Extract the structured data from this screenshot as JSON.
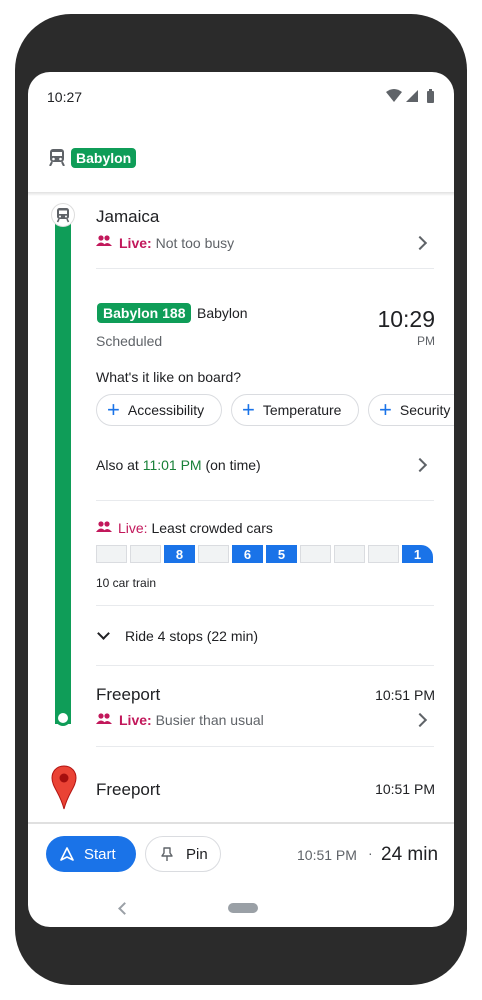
{
  "status_bar": {
    "time": "10:27"
  },
  "header": {
    "route_chip": "Babylon"
  },
  "stops": {
    "origin": {
      "name": "Jamaica",
      "live_label": "Live:",
      "live_status": "Not too busy"
    },
    "dest_stop": {
      "name": "Freeport",
      "time": "10:51 PM",
      "live_label": "Live:",
      "live_status": "Busier than usual"
    },
    "final": {
      "name": "Freeport",
      "time": "10:51 PM"
    }
  },
  "train": {
    "chip": "Babylon 188",
    "destination": "Babylon",
    "schedule_status": "Scheduled",
    "departure_time": "10:29",
    "departure_ampm": "PM",
    "onboard_question": "What's it like on board?",
    "onboard_chips": [
      "Accessibility",
      "Temperature",
      "Security"
    ],
    "also_at_prefix": "Also at",
    "also_at_time": "11:01 PM",
    "also_at_suffix": "(on time)"
  },
  "crowding": {
    "live_label": "Live:",
    "text": "Least crowded cars",
    "cars": [
      "",
      "",
      "8",
      "",
      "6",
      "5",
      "",
      "",
      "",
      "1"
    ],
    "caption": "10 car train"
  },
  "ride": {
    "label": "Ride 4 stops (22 min)"
  },
  "bottom_bar": {
    "start_label": "Start",
    "pin_label": "Pin",
    "arrival": "10:51 PM",
    "separator": "·",
    "duration": "24 min"
  },
  "colors": {
    "line": "#0f9d58",
    "accent": "#1a73e8",
    "live": "#c2185b",
    "on_time": "#188038"
  }
}
